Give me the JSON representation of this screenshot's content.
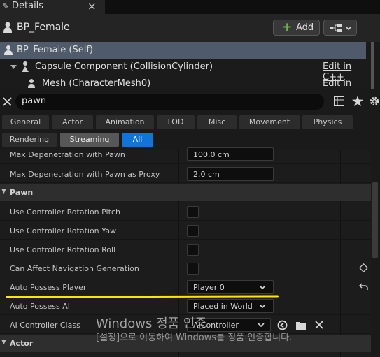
{
  "window": {
    "tab_label": "Details",
    "tab_close": "×"
  },
  "header": {
    "title": "BP_Female",
    "add_label": "Add"
  },
  "tree": {
    "items": [
      {
        "label": "BP_Female (Self)"
      },
      {
        "label": "Capsule Component (CollisionCylinder)",
        "link": "Edit in C++"
      },
      {
        "label": "Mesh (CharacterMesh0)",
        "link": "Edit in C++"
      }
    ]
  },
  "search": {
    "value": "pawn"
  },
  "categories": [
    "General",
    "Actor",
    "Animation",
    "LOD",
    "Misc",
    "Movement",
    "Physics",
    "Rendering",
    "Streaming",
    "All"
  ],
  "properties": {
    "max_depen_pawn": {
      "label": "Max Depenetration with Pawn",
      "value": "100.0 cm"
    },
    "max_depen_proxy": {
      "label": "Max Depenetration with Pawn as Proxy",
      "value": "2.0 cm"
    },
    "pawn_section": "Pawn",
    "rows": [
      {
        "label": "Use Controller Rotation Pitch"
      },
      {
        "label": "Use Controller Rotation Yaw"
      },
      {
        "label": "Use Controller Rotation Roll"
      },
      {
        "label": "Can Affect Navigation Generation"
      }
    ],
    "auto_possess_player": {
      "label": "Auto Possess Player",
      "value": "Player 0"
    },
    "auto_possess_ai": {
      "label": "Auto Possess AI",
      "value": "Placed in World"
    },
    "ai_controller_class": {
      "label": "AI Controller Class",
      "value": "AIController"
    },
    "actor_section": "Actor"
  },
  "watermark": {
    "line1": "Windows 정품 인증",
    "line2": "[설정]으로 이동하여 Windows를 정품 인증합니다."
  }
}
